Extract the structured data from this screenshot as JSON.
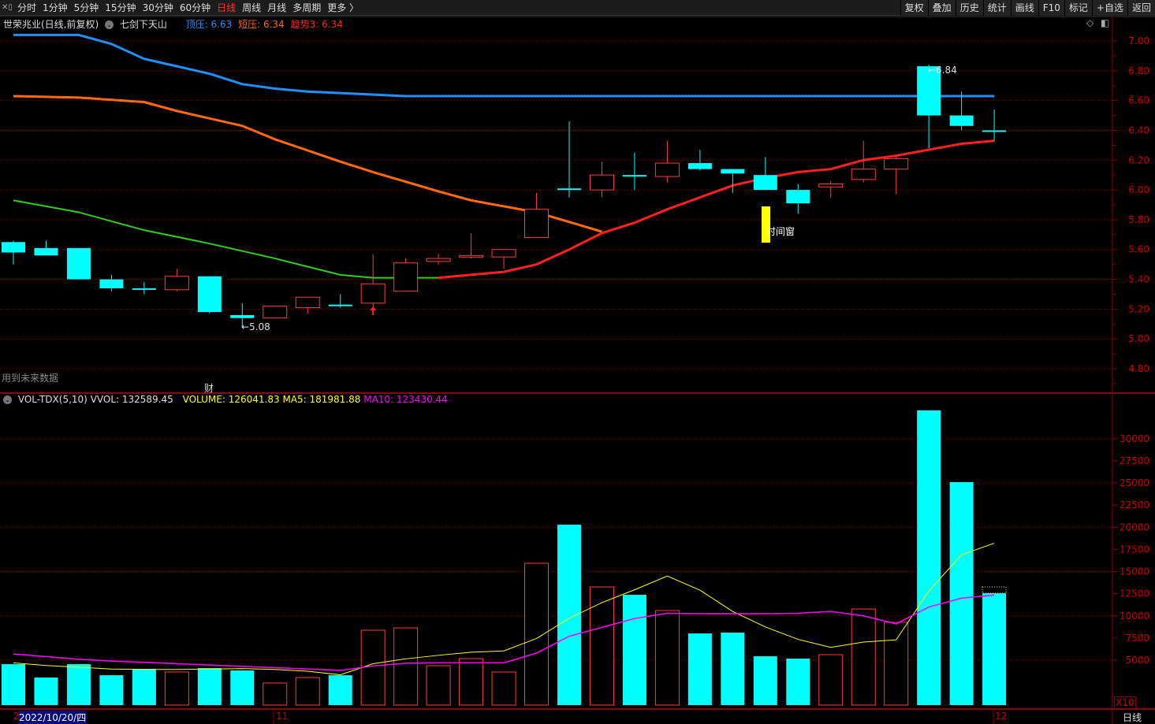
{
  "topbar": {
    "tabs": [
      {
        "label": "分时"
      },
      {
        "label": "1分钟"
      },
      {
        "label": "5分钟"
      },
      {
        "label": "15分钟"
      },
      {
        "label": "30分钟"
      },
      {
        "label": "60分钟"
      },
      {
        "label": "日线",
        "active": true
      },
      {
        "label": "周线"
      },
      {
        "label": "月线"
      },
      {
        "label": "多周期"
      },
      {
        "label": "更多 〉"
      }
    ],
    "buttons": [
      {
        "label": "复权"
      },
      {
        "label": "叠加"
      },
      {
        "label": "历史"
      },
      {
        "label": "统计"
      },
      {
        "label": "画线"
      },
      {
        "label": "F10"
      },
      {
        "label": "标记"
      },
      {
        "label": "+自选"
      },
      {
        "label": "返回"
      }
    ]
  },
  "info": {
    "title": "世荣兆业(日线,前复权)",
    "indicator": "七剑下天山",
    "top_press": "顶压: 6.63",
    "short_press": "短压: 6.34",
    "trend": "趋势3: 6.34"
  },
  "vol_info": {
    "name": "VOL-TDX(5,10)",
    "vvol": "VVOL: 132589.45",
    "volume": "VOLUME: 126041.83",
    "ma5": "MA5: 181981.88",
    "ma10": "MA10: 123430.44"
  },
  "annotations": {
    "future_data": "用到未来数据",
    "cai": "财",
    "low_label": "←5.08",
    "high_label": "←6.84",
    "time_window": "时间窗",
    "x10": "X10",
    "period": "日线"
  },
  "x_axis": {
    "date": "2022/10/20/四",
    "start_tick": "2",
    "month_11": "11",
    "month_12": "12"
  },
  "colors": {
    "up": "#ff3c3c",
    "down": "#00ffff",
    "blue_line": "#1e90ff",
    "orange_line": "#ff6a10",
    "green_line": "#33cc22",
    "red_line": "#ff2020",
    "ma5": "#ffff00",
    "ma10": "#ff00ff",
    "grid": "#8b0000",
    "axis_text": "#cc0000"
  },
  "chart_data": [
    {
      "type": "candlestick",
      "ylim": [
        4.7,
        7.1
      ],
      "yticks": [
        "7.00",
        "6.80",
        "6.60",
        "6.40",
        "6.20",
        "6.00",
        "5.80",
        "5.60",
        "5.40",
        "5.20",
        "5.00",
        "4.80"
      ],
      "ohlc": [
        [
          5.65,
          5.66,
          5.5,
          5.58
        ],
        [
          5.61,
          5.66,
          5.56,
          5.56
        ],
        [
          5.61,
          5.61,
          5.4,
          5.4
        ],
        [
          5.4,
          5.43,
          5.32,
          5.34
        ],
        [
          5.34,
          5.38,
          5.3,
          5.34
        ],
        [
          5.33,
          5.47,
          5.32,
          5.42
        ],
        [
          5.42,
          5.42,
          5.17,
          5.18
        ],
        [
          5.16,
          5.24,
          5.08,
          5.14
        ],
        [
          5.14,
          5.22,
          5.14,
          5.22
        ],
        [
          5.21,
          5.28,
          5.17,
          5.28
        ],
        [
          5.23,
          5.3,
          5.21,
          5.23
        ],
        [
          5.24,
          5.57,
          5.19,
          5.37
        ],
        [
          5.32,
          5.54,
          5.32,
          5.51
        ],
        [
          5.52,
          5.57,
          5.5,
          5.54
        ],
        [
          5.55,
          5.71,
          5.54,
          5.56
        ],
        [
          5.55,
          5.6,
          5.47,
          5.6
        ],
        [
          5.68,
          5.98,
          5.68,
          5.87
        ],
        [
          6.01,
          6.46,
          5.95,
          6.01
        ],
        [
          6.0,
          6.19,
          5.95,
          6.1
        ],
        [
          6.1,
          6.25,
          6.0,
          6.1
        ],
        [
          6.09,
          6.33,
          6.05,
          6.18
        ],
        [
          6.18,
          6.27,
          6.13,
          6.14
        ],
        [
          6.14,
          6.14,
          5.98,
          6.11
        ],
        [
          6.1,
          6.22,
          6.1,
          6.0
        ],
        [
          6.0,
          6.04,
          5.84,
          5.91
        ],
        [
          6.02,
          6.06,
          5.95,
          6.04
        ],
        [
          6.07,
          6.33,
          6.05,
          6.14
        ],
        [
          6.14,
          6.23,
          5.97,
          6.21
        ],
        [
          6.83,
          6.84,
          6.28,
          6.5
        ],
        [
          6.5,
          6.66,
          6.4,
          6.43
        ],
        [
          6.4,
          6.54,
          6.33,
          6.4
        ]
      ],
      "lines": {
        "blue": [
          [
            0,
            7.04
          ],
          [
            2,
            7.04
          ],
          [
            3,
            6.98
          ],
          [
            4,
            6.88
          ],
          [
            5,
            6.83
          ],
          [
            6,
            6.78
          ],
          [
            7,
            6.71
          ],
          [
            8,
            6.68
          ],
          [
            9,
            6.66
          ],
          [
            10,
            6.65
          ],
          [
            12,
            6.63
          ],
          [
            30,
            6.63
          ]
        ],
        "orange": [
          [
            0,
            6.63
          ],
          [
            2,
            6.62
          ],
          [
            4,
            6.59
          ],
          [
            5,
            6.53
          ],
          [
            7,
            6.43
          ],
          [
            8,
            6.34
          ],
          [
            10,
            6.19
          ],
          [
            11,
            6.12
          ],
          [
            13,
            5.99
          ],
          [
            14,
            5.93
          ],
          [
            16,
            5.85
          ],
          [
            18,
            5.72
          ]
        ],
        "green": [
          [
            0,
            5.93
          ],
          [
            1,
            5.89
          ],
          [
            2,
            5.85
          ],
          [
            4,
            5.73
          ],
          [
            6,
            5.64
          ],
          [
            8,
            5.54
          ],
          [
            10,
            5.43
          ],
          [
            11,
            5.41
          ],
          [
            13,
            5.41
          ]
        ],
        "red": [
          [
            13,
            5.41
          ],
          [
            15,
            5.45
          ],
          [
            16,
            5.5
          ],
          [
            17,
            5.6
          ],
          [
            18,
            5.71
          ],
          [
            19,
            5.78
          ],
          [
            20,
            5.87
          ],
          [
            21,
            5.95
          ],
          [
            22,
            6.03
          ],
          [
            23,
            6.08
          ],
          [
            24,
            6.12
          ],
          [
            25,
            6.14
          ],
          [
            26,
            6.2
          ],
          [
            27,
            6.23
          ],
          [
            28,
            6.27
          ],
          [
            29,
            6.31
          ],
          [
            30,
            6.33
          ]
        ]
      }
    },
    {
      "type": "bar",
      "unit": "X10",
      "ylim": [
        0,
        34000
      ],
      "yticks": [
        "30000",
        "27500",
        "25000",
        "22500",
        "20000",
        "17500",
        "15000",
        "12500",
        "10000",
        "7500",
        "5000"
      ],
      "volumes": [
        4550,
        3040,
        4550,
        3300,
        4020,
        3670,
        4110,
        3840,
        2420,
        3040,
        3300,
        8380,
        8650,
        4380,
        5180,
        3670,
        15940,
        20300,
        13270,
        12380,
        10600,
        8020,
        8110,
        5440,
        5180,
        5620,
        10780,
        9270,
        33200,
        25100,
        12560
      ],
      "last_projected": 13270,
      "ma5": [
        4700,
        4400,
        4200,
        4000,
        3950,
        3950,
        4000,
        4050,
        3950,
        3750,
        3350,
        4600,
        5150,
        5550,
        5900,
        6050,
        7450,
        9730,
        11500,
        12950,
        14500,
        12900,
        10500,
        8750,
        7350,
        6450,
        7050,
        7300,
        12800,
        16900,
        18200
      ],
      "ma10": [
        5700,
        5400,
        5100,
        4900,
        4750,
        4600,
        4450,
        4300,
        4150,
        4000,
        3850,
        4350,
        4650,
        4700,
        4700,
        4700,
        5800,
        7700,
        8700,
        9700,
        10300,
        10250,
        10250,
        10250,
        10300,
        10500,
        10000,
        9100,
        11000,
        12000,
        12350
      ]
    }
  ]
}
